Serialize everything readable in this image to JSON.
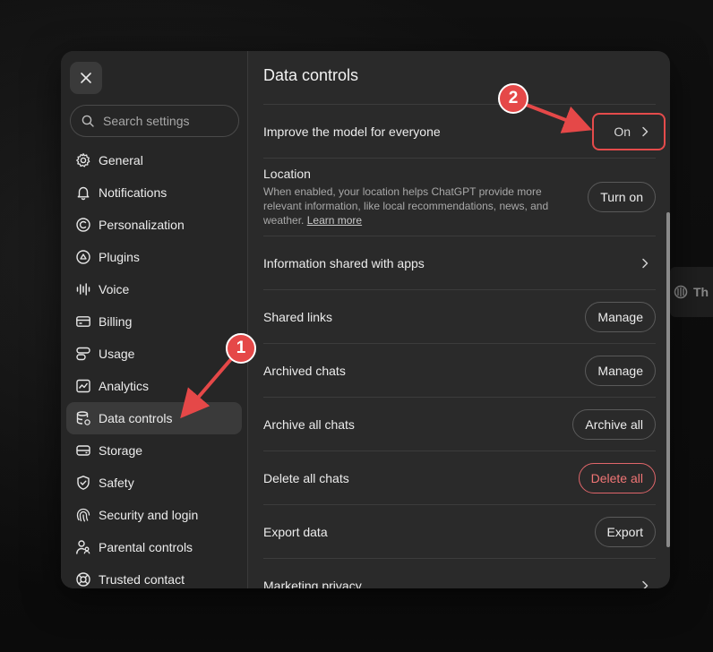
{
  "sidebar": {
    "search_placeholder": "Search settings",
    "items": [
      {
        "label": "General",
        "icon": "gear-icon"
      },
      {
        "label": "Notifications",
        "icon": "bell-icon"
      },
      {
        "label": "Personalization",
        "icon": "personalization-icon"
      },
      {
        "label": "Plugins",
        "icon": "plugin-icon"
      },
      {
        "label": "Voice",
        "icon": "waveform-icon"
      },
      {
        "label": "Billing",
        "icon": "credit-card-icon"
      },
      {
        "label": "Usage",
        "icon": "usage-icon"
      },
      {
        "label": "Analytics",
        "icon": "chart-icon"
      },
      {
        "label": "Data controls",
        "icon": "database-icon",
        "active": true
      },
      {
        "label": "Storage",
        "icon": "drive-icon"
      },
      {
        "label": "Safety",
        "icon": "shield-icon"
      },
      {
        "label": "Security and login",
        "icon": "fingerprint-icon"
      },
      {
        "label": "Parental controls",
        "icon": "parent-icon"
      },
      {
        "label": "Trusted contact",
        "icon": "lifebuoy-icon"
      }
    ]
  },
  "content": {
    "title": "Data controls",
    "improve": {
      "label": "Improve the model for everyone",
      "value": "On"
    },
    "location": {
      "label": "Location",
      "description": "When enabled, your location helps ChatGPT provide more relevant information, like local recommendations, news, and weather.",
      "link": "Learn more",
      "button": "Turn on"
    },
    "info_shared": {
      "label": "Information shared with apps"
    },
    "shared_links": {
      "label": "Shared links",
      "button": "Manage"
    },
    "archived_chats": {
      "label": "Archived chats",
      "button": "Manage"
    },
    "archive_all": {
      "label": "Archive all chats",
      "button": "Archive all"
    },
    "delete_all": {
      "label": "Delete all chats",
      "button": "Delete all"
    },
    "export": {
      "label": "Export data",
      "button": "Export"
    },
    "marketing": {
      "label": "Marketing privacy"
    }
  },
  "annotations": {
    "badge1": "1",
    "badge2": "2",
    "color": "#e54848"
  },
  "background": {
    "chip_text": "Th"
  }
}
